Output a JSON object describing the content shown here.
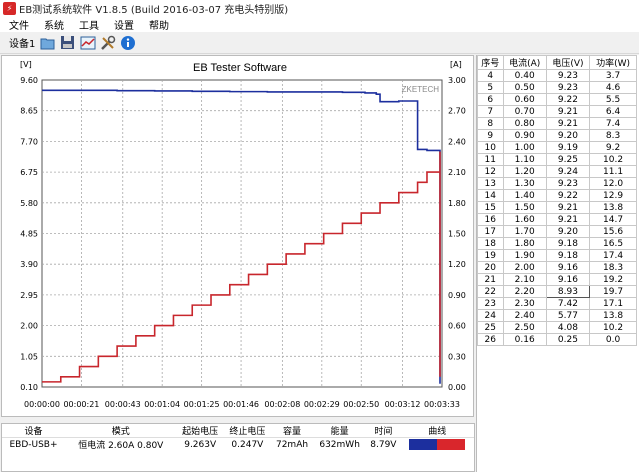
{
  "window": {
    "title": "EB测试系统软件 V1.8.5 (Build 2016-03-07 充电头特别版)"
  },
  "menu": [
    "文件",
    "系统",
    "工具",
    "设置",
    "帮助"
  ],
  "toolbar": {
    "device_label": "设备1"
  },
  "colors": {
    "voltage": "#1c2f9e",
    "current": "#c8262c",
    "grid": "#a8a8a8",
    "axis": "#000000"
  },
  "chart_data": {
    "type": "line",
    "title": "EB Tester Software",
    "watermark": "ZKETECH",
    "left_unit": "[V]",
    "right_unit": "[A]",
    "x_ticks": [
      "00:00:00",
      "00:00:21",
      "00:00:43",
      "00:01:04",
      "00:01:25",
      "00:01:46",
      "00:02:08",
      "00:02:29",
      "00:02:50",
      "00:03:12",
      "00:03:33"
    ],
    "x_seconds": [
      0,
      21,
      43,
      64,
      85,
      106,
      128,
      149,
      170,
      192,
      213
    ],
    "xlim": [
      0,
      213
    ],
    "y_left_ticks": [
      "9.60",
      "8.65",
      "7.70",
      "6.75",
      "5.80",
      "4.85",
      "3.90",
      "2.95",
      "2.00",
      "1.05",
      "0.10"
    ],
    "y_left_lim": [
      0.1,
      9.6
    ],
    "y_right_ticks": [
      "3.00",
      "2.70",
      "2.40",
      "2.10",
      "1.80",
      "1.50",
      "1.20",
      "0.90",
      "0.60",
      "0.30",
      "0.00"
    ],
    "y_right_lim": [
      0,
      3
    ],
    "series": [
      {
        "name": "电压(V)",
        "axis": "left",
        "x": [
          0,
          20,
          40,
          60,
          80,
          100,
          120,
          140,
          160,
          172,
          178,
          180,
          190,
          196,
          200,
          205,
          212,
          215,
          218,
          220,
          222
        ],
        "y": [
          9.28,
          9.28,
          9.27,
          9.26,
          9.25,
          9.24,
          9.23,
          9.23,
          9.22,
          9.2,
          9.16,
          8.93,
          8.95,
          8.95,
          7.45,
          7.42,
          7.4,
          5.77,
          4.08,
          0.25,
          0.2
        ]
      },
      {
        "name": "电流(A)",
        "axis": "right",
        "x": [
          0,
          10,
          20,
          30,
          40,
          50,
          60,
          70,
          80,
          90,
          100,
          110,
          120,
          130,
          140,
          150,
          160,
          170,
          180,
          190,
          200,
          205,
          212,
          215,
          218,
          222
        ],
        "y": [
          0.05,
          0.1,
          0.2,
          0.3,
          0.4,
          0.5,
          0.6,
          0.7,
          0.8,
          0.9,
          1.0,
          1.1,
          1.2,
          1.3,
          1.4,
          1.5,
          1.6,
          1.7,
          1.8,
          1.9,
          2.0,
          2.1,
          2.2,
          2.3,
          1.7,
          0.1
        ]
      }
    ]
  },
  "table": {
    "headers": [
      "序号",
      "电流(A)",
      "电压(V)",
      "功率(W)"
    ],
    "rows": [
      [
        "4",
        "0.40",
        "9.23",
        "3.7"
      ],
      [
        "5",
        "0.50",
        "9.23",
        "4.6"
      ],
      [
        "6",
        "0.60",
        "9.22",
        "5.5"
      ],
      [
        "7",
        "0.70",
        "9.21",
        "6.4"
      ],
      [
        "8",
        "0.80",
        "9.21",
        "7.4"
      ],
      [
        "9",
        "0.90",
        "9.20",
        "8.3"
      ],
      [
        "10",
        "1.00",
        "9.19",
        "9.2"
      ],
      [
        "11",
        "1.10",
        "9.25",
        "10.2"
      ],
      [
        "12",
        "1.20",
        "9.24",
        "11.1"
      ],
      [
        "13",
        "1.30",
        "9.23",
        "12.0"
      ],
      [
        "14",
        "1.40",
        "9.22",
        "12.9"
      ],
      [
        "15",
        "1.50",
        "9.21",
        "13.8"
      ],
      [
        "16",
        "1.60",
        "9.21",
        "14.7"
      ],
      [
        "17",
        "1.70",
        "9.20",
        "15.6"
      ],
      [
        "18",
        "1.80",
        "9.18",
        "16.5"
      ],
      [
        "19",
        "1.90",
        "9.18",
        "17.4"
      ],
      [
        "20",
        "2.00",
        "9.16",
        "18.3"
      ],
      [
        "21",
        "2.10",
        "9.16",
        "19.2"
      ],
      [
        "22",
        "2.20",
        "8.93",
        "19.7"
      ],
      [
        "23",
        "2.30",
        "7.42",
        "17.1"
      ],
      [
        "24",
        "2.40",
        "5.77",
        "13.8"
      ],
      [
        "25",
        "2.50",
        "4.08",
        "10.2"
      ],
      [
        "26",
        "0.16",
        "0.25",
        "0.0"
      ]
    ]
  },
  "status": {
    "headers": [
      "设备",
      "模式",
      "起始电压",
      "终止电压",
      "容量",
      "能量",
      "时间",
      "曲线"
    ],
    "device": "EBD-USB+",
    "mode": "恒电流 2.60A 0.80V",
    "start_voltage": "9.263V",
    "end_voltage": "0.247V",
    "capacity": "72mAh",
    "energy": "632mWh",
    "time": "8.79V"
  }
}
